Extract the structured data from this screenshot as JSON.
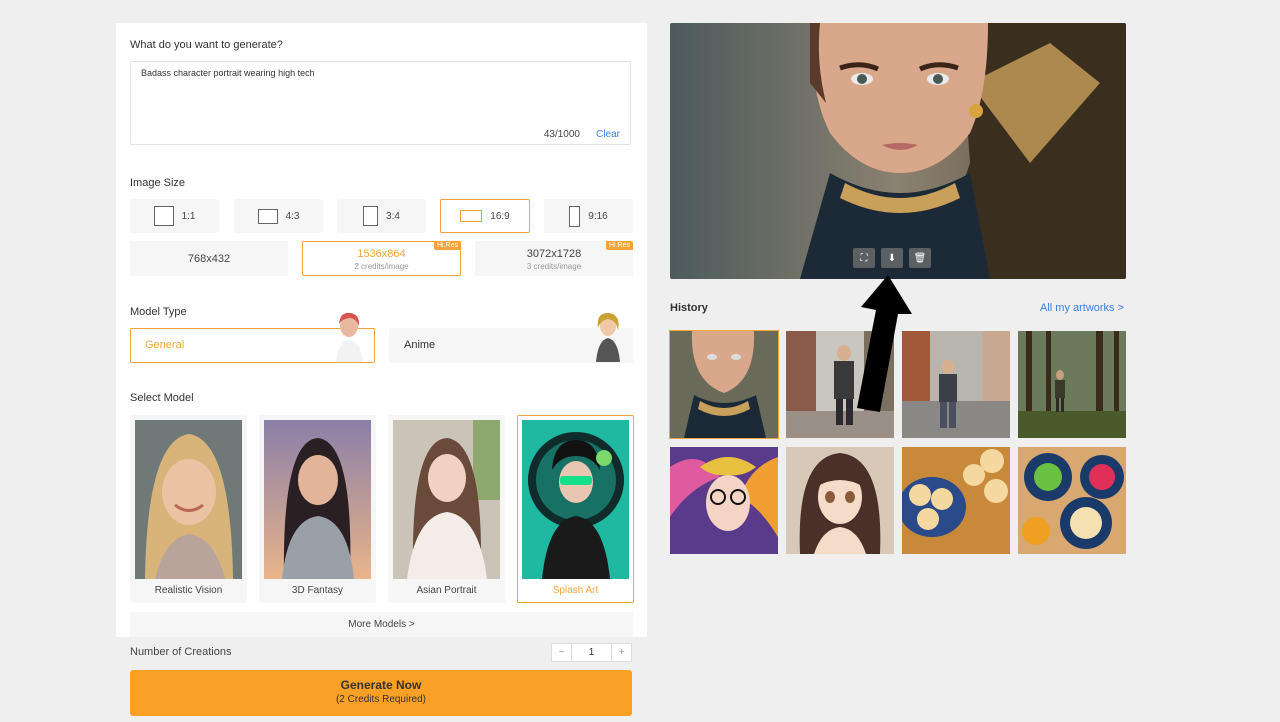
{
  "prompt": {
    "label": "What do you want to generate?",
    "value": "Badass character portrait wearing high tech",
    "counter": "43/1000",
    "clear_label": "Clear"
  },
  "image_size": {
    "label": "Image Size",
    "ratios": [
      {
        "label": "1:1",
        "selected": false
      },
      {
        "label": "4:3",
        "selected": false
      },
      {
        "label": "3:4",
        "selected": false
      },
      {
        "label": "16:9",
        "selected": true
      },
      {
        "label": "9:16",
        "selected": false
      }
    ],
    "resolutions": [
      {
        "label": "768x432",
        "credits": "",
        "badge": "",
        "selected": false
      },
      {
        "label": "1536x864",
        "credits": "2 credits/image",
        "badge": "Hi.Res",
        "selected": true
      },
      {
        "label": "3072x1728",
        "credits": "3 credits/image",
        "badge": "Hi.Res",
        "selected": false
      }
    ]
  },
  "model_type": {
    "label": "Model Type",
    "options": [
      {
        "label": "General",
        "selected": true
      },
      {
        "label": "Anime",
        "selected": false
      }
    ]
  },
  "select_model": {
    "label": "Select Model",
    "models": [
      {
        "name": "Realistic Vision",
        "selected": false
      },
      {
        "name": "3D Fantasy",
        "selected": false
      },
      {
        "name": "Asian Portrait",
        "selected": false
      },
      {
        "name": "Splash Art",
        "selected": true
      }
    ],
    "more_label": "More Models >"
  },
  "creations": {
    "label": "Number of Creations",
    "value": "1",
    "minus": "−",
    "plus": "+"
  },
  "generate": {
    "label": "Generate Now",
    "sub": "(2 Credits Required)"
  },
  "history": {
    "title": "History",
    "all_link": "All my artworks >"
  },
  "preview_tools": [
    "expand-icon",
    "download-icon",
    "trash-icon"
  ],
  "colors": {
    "accent": "#f4a43a",
    "button": "#fba026",
    "link": "#3d7fe0"
  }
}
